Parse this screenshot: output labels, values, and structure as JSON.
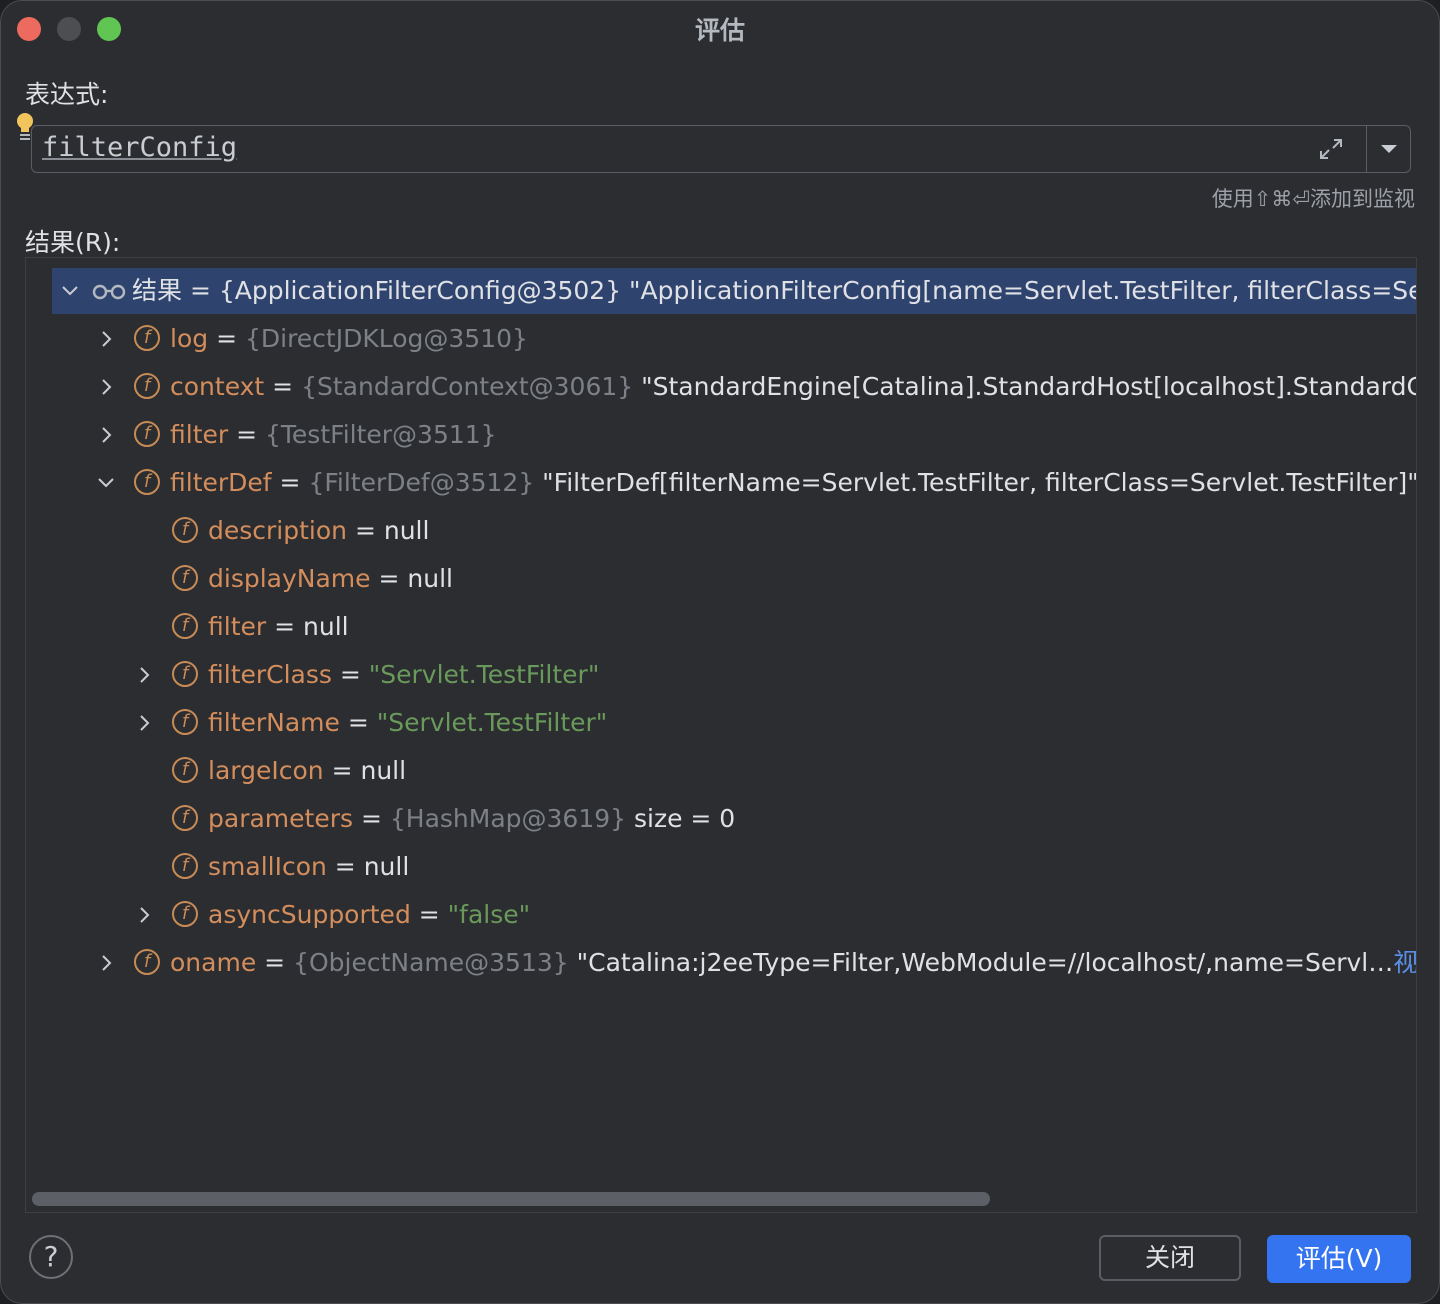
{
  "window": {
    "title": "评估"
  },
  "expression": {
    "label": "表达式:",
    "value": "filterConfig",
    "hint": "使用⇧⌘⏎添加到监视"
  },
  "results": {
    "label": "结果(R):",
    "rows": [
      {
        "name": "结果",
        "eq": " = ",
        "obj": "",
        "objAlt": "{ApplicationFilterConfig@3502}",
        "value": " \"ApplicationFilterConfig[name=Servlet.TestFilter, filterClass=Serv"
      },
      {
        "name": "log",
        "eq": " = ",
        "obj": "{DirectJDKLog@3510}",
        "value": ""
      },
      {
        "name": "context",
        "eq": " = ",
        "obj": "{StandardContext@3061}",
        "value": " \"StandardEngine[Catalina].StandardHost[localhost].StandardCon"
      },
      {
        "name": "filter",
        "eq": " = ",
        "obj": "{TestFilter@3511}",
        "value": ""
      },
      {
        "name": "filterDef",
        "eq": " = ",
        "obj": "{FilterDef@3512}",
        "value": " \"FilterDef[filterName=Servlet.TestFilter, filterClass=Servlet.TestFilter]\""
      },
      {
        "name": "description",
        "eq": " = ",
        "value": "null"
      },
      {
        "name": "displayName",
        "eq": " = ",
        "value": "null"
      },
      {
        "name": "filter",
        "eq": " = ",
        "value": "null"
      },
      {
        "name": "filterClass",
        "eq": " = ",
        "str": "\"Servlet.TestFilter\""
      },
      {
        "name": "filterName",
        "eq": " = ",
        "str": "\"Servlet.TestFilter\""
      },
      {
        "name": "largeIcon",
        "eq": " = ",
        "value": "null"
      },
      {
        "name": "parameters",
        "eq": " = ",
        "obj": "{HashMap@3619}",
        "value": "  size = 0"
      },
      {
        "name": "smallIcon",
        "eq": " = ",
        "value": "null"
      },
      {
        "name": "asyncSupported",
        "eq": " = ",
        "str": "\"false\""
      },
      {
        "name": "oname",
        "eq": " = ",
        "obj": "{ObjectName@3513}",
        "value": " \"Catalina:j2eeType=Filter,WebModule=//localhost/,name=Servl…",
        "link": "视图"
      }
    ]
  },
  "buttons": {
    "close": "关闭",
    "evaluate": "评估(V)",
    "help": "?"
  }
}
